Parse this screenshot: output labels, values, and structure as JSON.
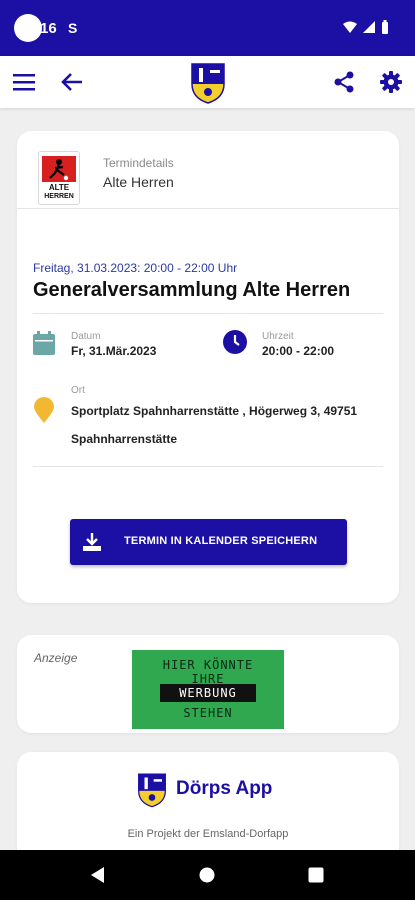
{
  "status": {
    "time": "16",
    "extra": "S"
  },
  "appbar": {
    "menu_icon": "menu-icon",
    "back_icon": "arrow-back-icon",
    "share_icon": "share-icon",
    "settings_icon": "gear-icon"
  },
  "header": {
    "subtitle": "Termindetails",
    "title": "Alte Herren",
    "logo_line1": "ALTE",
    "logo_line2": "HERREN"
  },
  "event": {
    "date_line": "Freitag, 31.03.2023: 20:00 - 22:00 Uhr",
    "title": "Generalversammlung Alte Herren",
    "date_label": "Datum",
    "date_value": "Fr, 31.Mär.2023",
    "time_label": "Uhrzeit",
    "time_value": "20:00 - 22:00",
    "place_label": "Ort",
    "place_value": "Sportplatz Spahnharrenstätte , Högerweg 3, 49751 Spahnharrenstätte"
  },
  "save_button": {
    "label": "TERMIN IN KALENDER SPEICHERN"
  },
  "ad": {
    "label": "Anzeige",
    "line1": "HIER KÖNNTE",
    "line2": "IHRE",
    "line3": "WERBUNG",
    "line4": "STEHEN"
  },
  "footer": {
    "app_name": "Dörps App",
    "subtitle": "Ein Projekt der Emsland-Dorfapp"
  },
  "colors": {
    "primary": "#1c0fa3",
    "calendar": "#6aa7a6",
    "pin": "#f2b832",
    "ad_bg": "#2fa84f"
  }
}
